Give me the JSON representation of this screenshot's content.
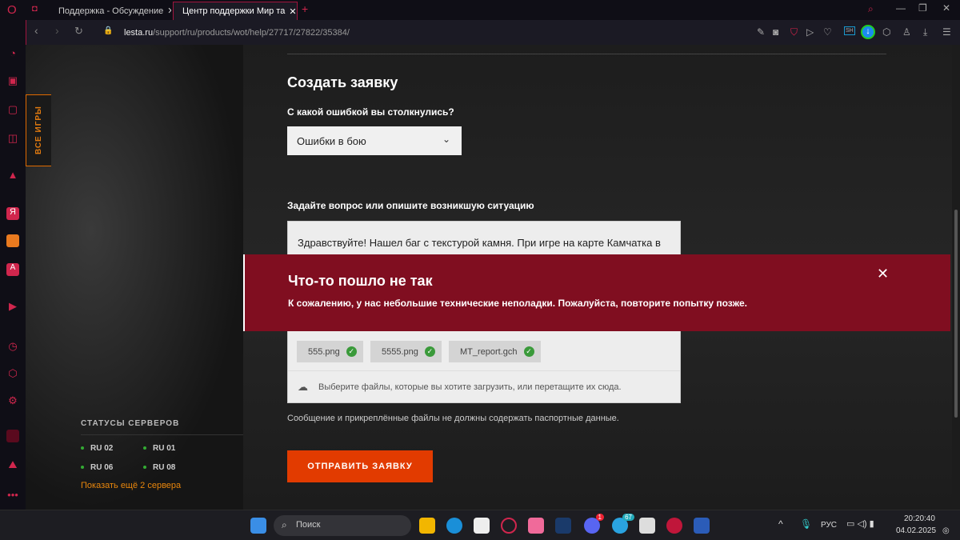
{
  "browser": {
    "tabs": [
      {
        "label": "Поддержка - Обсуждение"
      },
      {
        "label": "Центр поддержки Мир та",
        "active": true
      }
    ],
    "url_host": "lesta.ru",
    "url_path": "/support/ru/products/wot/help/27717/27822/35384/"
  },
  "side": {
    "all_games": "ВСЕ ИГРЫ"
  },
  "servers": {
    "title": "СТАТУСЫ СЕРВЕРОВ",
    "items": [
      "RU 02",
      "RU 01",
      "RU 06",
      "RU 08"
    ],
    "more": "Показать ещё 2 сервера"
  },
  "form": {
    "title": "Создать заявку",
    "q1": "С какой ошибкой вы столкнулись?",
    "q1_value": "Ошибки в бою",
    "q2": "Задайте вопрос или опишите возникшую ситуацию",
    "message": "Здравствуйте! Нашел баг с текстурой камня. При игре на карте Камчатка в",
    "files": [
      "555.png",
      "5555.png",
      "MT_report.gch"
    ],
    "drop_hint": "Выберите файлы, которые вы хотите загрузить, или перетащите их сюда.",
    "note": "Сообщение и прикреплённые файлы не должны содержать паспортные данные.",
    "submit": "ОТПРАВИТЬ ЗАЯВКУ"
  },
  "error": {
    "title": "Что-то пошло не так",
    "message": "К сожалению, у нас небольшие технические неполадки. Пожалуйста, повторите попытку позже."
  },
  "taskbar": {
    "search": "Поиск",
    "lang": "РУС",
    "time": "20:20:40",
    "date": "04.02.2025",
    "discord_badge": "1",
    "telegram_badge": "67"
  },
  "colors": {
    "accent": "#e23b00",
    "error": "#800e20",
    "opera": "#d0264d"
  }
}
